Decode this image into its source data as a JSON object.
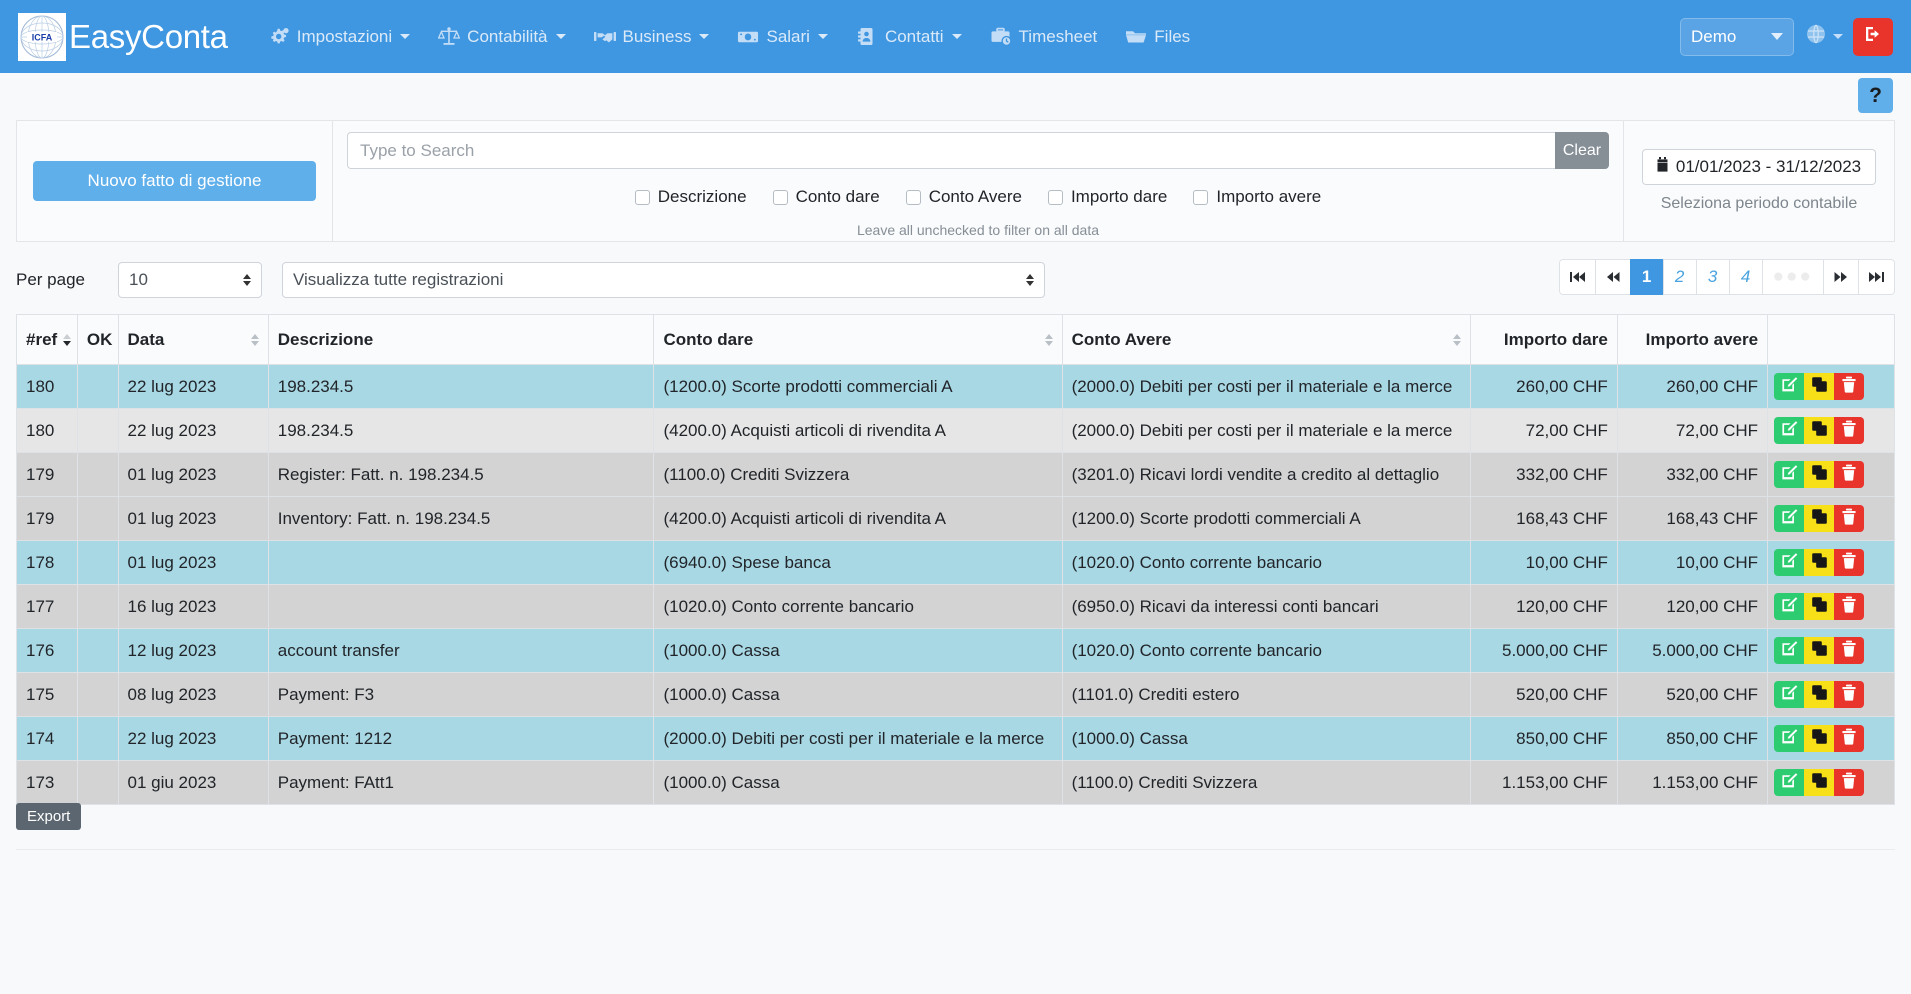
{
  "navbar": {
    "logo_text": "ICFA",
    "brand": "EasyConta",
    "items": [
      {
        "label": "Impostazioni",
        "icon": "gears-icon",
        "caret": true
      },
      {
        "label": "Contabilità",
        "icon": "scales-icon",
        "caret": true
      },
      {
        "label": "Business",
        "icon": "handshake-icon",
        "caret": true
      },
      {
        "label": "Salari",
        "icon": "banknote-icon",
        "caret": true
      },
      {
        "label": "Contatti",
        "icon": "address-book-icon",
        "caret": true
      },
      {
        "label": "Timesheet",
        "icon": "briefcase-clock-icon",
        "caret": false
      },
      {
        "label": "Files",
        "icon": "folder-icon",
        "caret": false
      }
    ],
    "company_selected": "Demo",
    "language_icon": "globe-icon",
    "logout_icon": "logout-icon"
  },
  "help": {
    "label": "?"
  },
  "filter": {
    "new_button": "Nuovo fatto di gestione",
    "search_placeholder": "Type to Search",
    "search_value": "",
    "clear_button": "Clear",
    "checkboxes": [
      {
        "label": "Descrizione",
        "checked": false
      },
      {
        "label": "Conto dare",
        "checked": false
      },
      {
        "label": "Conto Avere",
        "checked": false
      },
      {
        "label": "Importo dare",
        "checked": false
      },
      {
        "label": "Importo avere",
        "checked": false
      }
    ],
    "hint": "Leave all unchecked to filter on all data",
    "period_icon": "calendar-icon",
    "period_value": "01/01/2023 - 31/12/2023",
    "period_note": "Seleziona periodo contabile"
  },
  "controls": {
    "per_page_label": "Per page",
    "per_page_value": "10",
    "view_value": "Visualizza tutte registrazioni"
  },
  "pagination": {
    "first": "⏮",
    "prev": "◀◀",
    "pages": [
      "1",
      "2",
      "3",
      "4"
    ],
    "active": "1",
    "ellipsis": "●●●",
    "next": "▶▶",
    "last": "⏭"
  },
  "table": {
    "headers": [
      {
        "label": "#ref",
        "sortable": true,
        "align": "left"
      },
      {
        "label": "OK",
        "sortable": false,
        "align": "left"
      },
      {
        "label": "Data",
        "sortable": true,
        "align": "left"
      },
      {
        "label": "Descrizione",
        "sortable": false,
        "align": "left"
      },
      {
        "label": "Conto dare",
        "sortable": true,
        "align": "left"
      },
      {
        "label": "Conto Avere",
        "sortable": true,
        "align": "left"
      },
      {
        "label": "Importo dare",
        "sortable": false,
        "align": "right"
      },
      {
        "label": "Importo avere",
        "sortable": false,
        "align": "right"
      },
      {
        "label": "",
        "sortable": false,
        "align": "left"
      }
    ],
    "rows": [
      {
        "ref": "180",
        "ok": "",
        "data": "22 lug 2023",
        "descrizione": "198.234.5",
        "conto_dare": "(1200.0) Scorte prodotti commerciali A",
        "conto_avere": "(2000.0) Debiti per costi per il materiale e la merce",
        "importo_dare": "260,00 CHF",
        "importo_avere": "260,00 CHF",
        "style": "rblue"
      },
      {
        "ref": "180",
        "ok": "",
        "data": "22 lug 2023",
        "descrizione": "198.234.5",
        "conto_dare": "(4200.0) Acquisti articoli di rivendita A",
        "conto_avere": "(2000.0) Debiti per costi per il materiale e la merce",
        "importo_dare": "72,00 CHF",
        "importo_avere": "72,00 CHF",
        "style": "rlight"
      },
      {
        "ref": "179",
        "ok": "",
        "data": "01 lug 2023",
        "descrizione": "Register: Fatt. n. 198.234.5",
        "conto_dare": "(1100.0) Crediti Svizzera",
        "conto_avere": "(3201.0) Ricavi lordi vendite a credito al dettaglio",
        "importo_dare": "332,00 CHF",
        "importo_avere": "332,00 CHF",
        "style": "rgray"
      },
      {
        "ref": "179",
        "ok": "",
        "data": "01 lug 2023",
        "descrizione": "Inventory: Fatt. n. 198.234.5",
        "conto_dare": "(4200.0) Acquisti articoli di rivendita A",
        "conto_avere": "(1200.0) Scorte prodotti commerciali A",
        "importo_dare": "168,43 CHF",
        "importo_avere": "168,43 CHF",
        "style": "rgray"
      },
      {
        "ref": "178",
        "ok": "",
        "data": "01 lug 2023",
        "descrizione": "",
        "conto_dare": "(6940.0) Spese banca",
        "conto_avere": "(1020.0) Conto corrente bancario",
        "importo_dare": "10,00 CHF",
        "importo_avere": "10,00 CHF",
        "style": "rblue"
      },
      {
        "ref": "177",
        "ok": "",
        "data": "16 lug 2023",
        "descrizione": "",
        "conto_dare": "(1020.0) Conto corrente bancario",
        "conto_avere": "(6950.0) Ricavi da interessi conti bancari",
        "importo_dare": "120,00 CHF",
        "importo_avere": "120,00 CHF",
        "style": "rgray"
      },
      {
        "ref": "176",
        "ok": "",
        "data": "12 lug 2023",
        "descrizione": "account transfer",
        "conto_dare": "(1000.0) Cassa",
        "conto_avere": "(1020.0) Conto corrente bancario",
        "importo_dare": "5.000,00 CHF",
        "importo_avere": "5.000,00 CHF",
        "style": "rblue"
      },
      {
        "ref": "175",
        "ok": "",
        "data": "08 lug 2023",
        "descrizione": "Payment: F3",
        "conto_dare": "(1000.0) Cassa",
        "conto_avere": "(1101.0) Crediti estero",
        "importo_dare": "520,00 CHF",
        "importo_avere": "520,00 CHF",
        "style": "rgray"
      },
      {
        "ref": "174",
        "ok": "",
        "data": "22 lug 2023",
        "descrizione": "Payment: 1212",
        "conto_dare": "(2000.0) Debiti per costi per il materiale e la merce",
        "conto_avere": "(1000.0) Cassa",
        "importo_dare": "850,00 CHF",
        "importo_avere": "850,00 CHF",
        "style": "rblue"
      },
      {
        "ref": "173",
        "ok": "",
        "data": "01 giu 2023",
        "descrizione": "Payment: FAtt1",
        "conto_dare": "(1000.0) Cassa",
        "conto_avere": "(1100.0) Crediti Svizzera",
        "importo_dare": "1.153,00 CHF",
        "importo_avere": "1.153,00 CHF",
        "style": "rgray"
      }
    ],
    "row_actions": [
      {
        "name": "edit-row-button",
        "icon": "pencil-square-icon",
        "color": "#2ecc71"
      },
      {
        "name": "duplicate-row-button",
        "icon": "copy-icon",
        "color": "#f7e018"
      },
      {
        "name": "delete-row-button",
        "icon": "trash-icon",
        "color": "#e9342c"
      }
    ]
  },
  "export": {
    "label": "Export"
  },
  "colors": {
    "navbar": "#3f96e1",
    "primary": "#5fafeb",
    "danger": "#e9342c",
    "success": "#2ecc71",
    "warning": "#f7e018",
    "row_highlight": "#a9d8e5"
  }
}
